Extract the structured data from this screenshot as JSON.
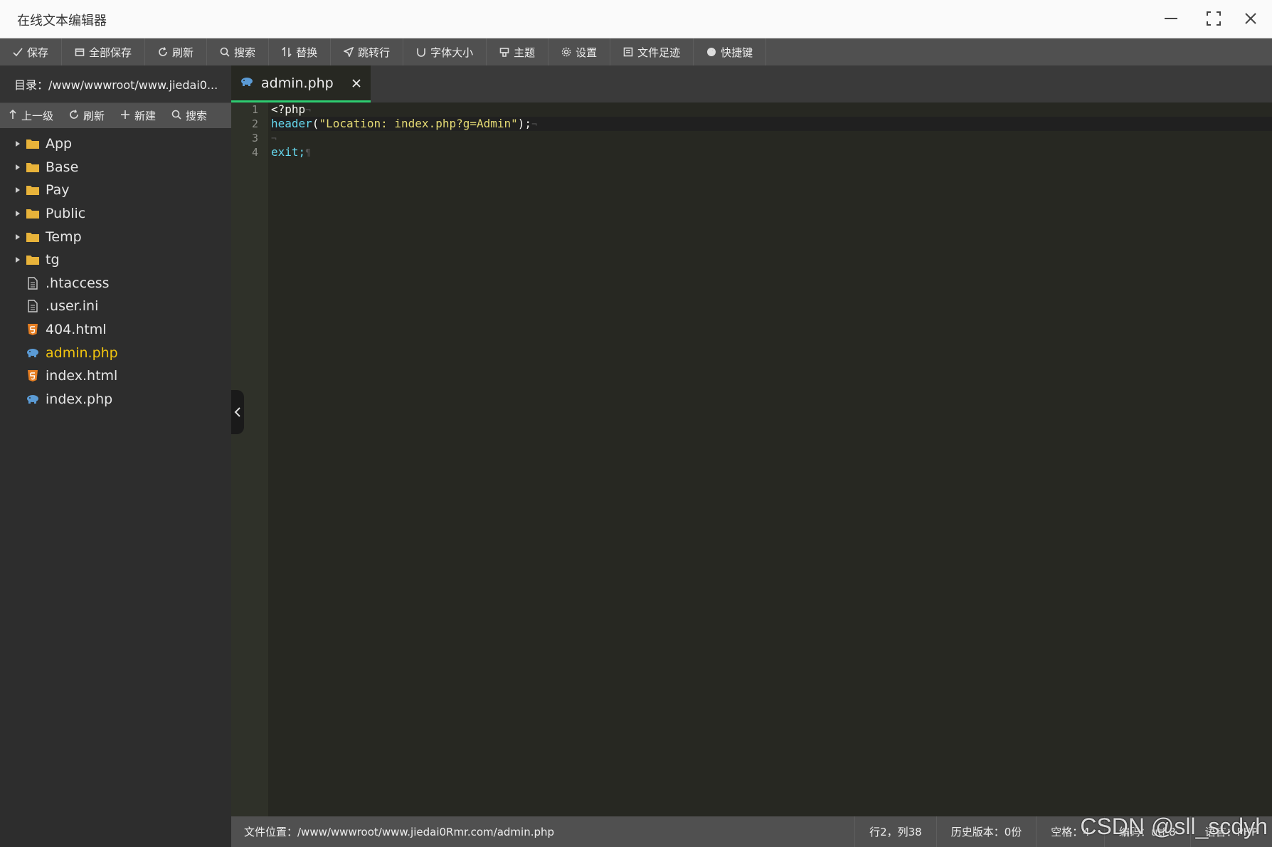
{
  "window": {
    "title": "在线文本编辑器"
  },
  "toolbar": {
    "items": [
      {
        "label": "保存",
        "icon": "check-icon"
      },
      {
        "label": "全部保存",
        "icon": "save-all-icon"
      },
      {
        "label": "刷新",
        "icon": "refresh-icon"
      },
      {
        "label": "搜索",
        "icon": "search-icon"
      },
      {
        "label": "替换",
        "icon": "replace-icon"
      },
      {
        "label": "跳转行",
        "icon": "navigate-icon"
      },
      {
        "label": "字体大小",
        "icon": "font-size-icon"
      },
      {
        "label": "主题",
        "icon": "theme-icon"
      },
      {
        "label": "设置",
        "icon": "gear-icon"
      },
      {
        "label": "文件足迹",
        "icon": "history-icon"
      },
      {
        "label": "快捷键",
        "icon": "help-icon"
      }
    ]
  },
  "sidebar": {
    "directory": "目录：/www/wwwroot/www.jiedai0...",
    "tools": [
      {
        "label": "上一级",
        "icon": "arrow-up-icon"
      },
      {
        "label": "刷新",
        "icon": "refresh-icon"
      },
      {
        "label": "新建",
        "icon": "plus-icon"
      },
      {
        "label": "搜索",
        "icon": "search-icon"
      }
    ],
    "files": [
      {
        "name": "App",
        "type": "folder"
      },
      {
        "name": "Base",
        "type": "folder"
      },
      {
        "name": "Pay",
        "type": "folder"
      },
      {
        "name": "Public",
        "type": "folder"
      },
      {
        "name": "Temp",
        "type": "folder"
      },
      {
        "name": "tg",
        "type": "folder"
      },
      {
        "name": ".htaccess",
        "type": "text"
      },
      {
        "name": ".user.ini",
        "type": "text"
      },
      {
        "name": "404.html",
        "type": "html"
      },
      {
        "name": "admin.php",
        "type": "php",
        "active": true
      },
      {
        "name": "index.html",
        "type": "html"
      },
      {
        "name": "index.php",
        "type": "php"
      }
    ]
  },
  "tab": {
    "name": "admin.php"
  },
  "editor": {
    "line_numbers": [
      "1",
      "2",
      "3",
      "4"
    ],
    "lines": {
      "l1": "<?php",
      "l2_func": "header",
      "l2_open": "(",
      "l2_str": "\"Location: index.php?g=Admin\"",
      "l2_close": ");",
      "l4": "exit;"
    },
    "active_line": 2
  },
  "status": {
    "path": "文件位置：/www/wwwroot/www.jiedai0Rmr.com/admin.php",
    "cursor": "行2，列38",
    "history": "历史版本：0份",
    "indent": "空格：4",
    "encoding": "编码：utf-8",
    "language": "语言：PHP"
  },
  "watermark": "CSDN @sll_scdyh",
  "colors": {
    "accent": "#2ecc71",
    "active_file": "#f1c40f",
    "folder": "#e8b33a",
    "html_icon": "#e67e22",
    "php_icon": "#5b9bd5"
  }
}
